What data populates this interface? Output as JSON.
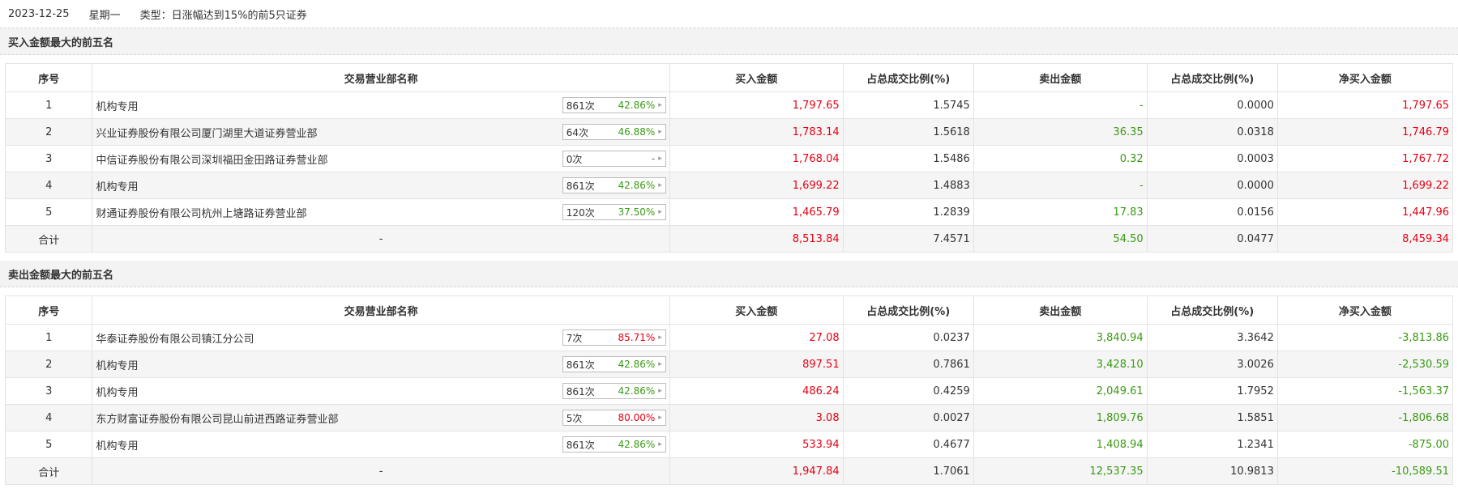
{
  "header": {
    "date": "2023-12-25",
    "weekday": "星期一",
    "type": "类型：日涨幅达到15%的前5只证券"
  },
  "buy": {
    "title": "买入金额最大的前五名",
    "columns": [
      "序号",
      "交易营业部名称",
      "买入金额",
      "占总成交比例(%)",
      "卖出金额",
      "占总成交比例(%)",
      "净买入金额"
    ],
    "rows": [
      {
        "idx": "1",
        "name": "机构专用",
        "count": "861次",
        "pct": "42.86%",
        "pct_color": "green",
        "buy": "1,797.65",
        "buy_ratio": "1.5745",
        "sell": "-",
        "sell_ratio": "0.0000",
        "net": "1,797.65",
        "net_color": "red"
      },
      {
        "idx": "2",
        "name": "兴业证券股份有限公司厦门湖里大道证券营业部",
        "count": "64次",
        "pct": "46.88%",
        "pct_color": "green",
        "buy": "1,783.14",
        "buy_ratio": "1.5618",
        "sell": "36.35",
        "sell_ratio": "0.0318",
        "net": "1,746.79",
        "net_color": "red"
      },
      {
        "idx": "3",
        "name": "中信证券股份有限公司深圳福田金田路证券营业部",
        "count": "0次",
        "pct": "-",
        "pct_color": "gray",
        "buy": "1,768.04",
        "buy_ratio": "1.5486",
        "sell": "0.32",
        "sell_ratio": "0.0003",
        "net": "1,767.72",
        "net_color": "red"
      },
      {
        "idx": "4",
        "name": "机构专用",
        "count": "861次",
        "pct": "42.86%",
        "pct_color": "green",
        "buy": "1,699.22",
        "buy_ratio": "1.4883",
        "sell": "-",
        "sell_ratio": "0.0000",
        "net": "1,699.22",
        "net_color": "red"
      },
      {
        "idx": "5",
        "name": "财通证券股份有限公司杭州上塘路证券营业部",
        "count": "120次",
        "pct": "37.50%",
        "pct_color": "green",
        "buy": "1,465.79",
        "buy_ratio": "1.2839",
        "sell": "17.83",
        "sell_ratio": "0.0156",
        "net": "1,447.96",
        "net_color": "red"
      }
    ],
    "total": {
      "label": "合计",
      "name": "-",
      "buy": "8,513.84",
      "buy_ratio": "7.4571",
      "sell": "54.50",
      "sell_ratio": "0.0477",
      "net": "8,459.34",
      "net_color": "red"
    }
  },
  "sell": {
    "title": "卖出金额最大的前五名",
    "columns": [
      "序号",
      "交易营业部名称",
      "买入金额",
      "占总成交比例(%)",
      "卖出金额",
      "占总成交比例(%)",
      "净买入金额"
    ],
    "rows": [
      {
        "idx": "1",
        "name": "华泰证券股份有限公司镇江分公司",
        "count": "7次",
        "pct": "85.71%",
        "pct_color": "red",
        "buy": "27.08",
        "buy_ratio": "0.0237",
        "sell": "3,840.94",
        "sell_ratio": "3.3642",
        "net": "-3,813.86",
        "net_color": "green"
      },
      {
        "idx": "2",
        "name": "机构专用",
        "count": "861次",
        "pct": "42.86%",
        "pct_color": "green",
        "buy": "897.51",
        "buy_ratio": "0.7861",
        "sell": "3,428.10",
        "sell_ratio": "3.0026",
        "net": "-2,530.59",
        "net_color": "green"
      },
      {
        "idx": "3",
        "name": "机构专用",
        "count": "861次",
        "pct": "42.86%",
        "pct_color": "green",
        "buy": "486.24",
        "buy_ratio": "0.4259",
        "sell": "2,049.61",
        "sell_ratio": "1.7952",
        "net": "-1,563.37",
        "net_color": "green"
      },
      {
        "idx": "4",
        "name": "东方财富证券股份有限公司昆山前进西路证券营业部",
        "count": "5次",
        "pct": "80.00%",
        "pct_color": "red",
        "buy": "3.08",
        "buy_ratio": "0.0027",
        "sell": "1,809.76",
        "sell_ratio": "1.5851",
        "net": "-1,806.68",
        "net_color": "green"
      },
      {
        "idx": "5",
        "name": "机构专用",
        "count": "861次",
        "pct": "42.86%",
        "pct_color": "green",
        "buy": "533.94",
        "buy_ratio": "0.4677",
        "sell": "1,408.94",
        "sell_ratio": "1.2341",
        "net": "-875.00",
        "net_color": "green"
      }
    ],
    "total": {
      "label": "合计",
      "name": "-",
      "buy": "1,947.84",
      "buy_ratio": "1.7061",
      "sell": "12,537.35",
      "sell_ratio": "10.9813",
      "net": "-10,589.51",
      "net_color": "green"
    }
  },
  "colors": {
    "red": "#e60012",
    "green": "#3a9a14",
    "gray": "#666666"
  }
}
